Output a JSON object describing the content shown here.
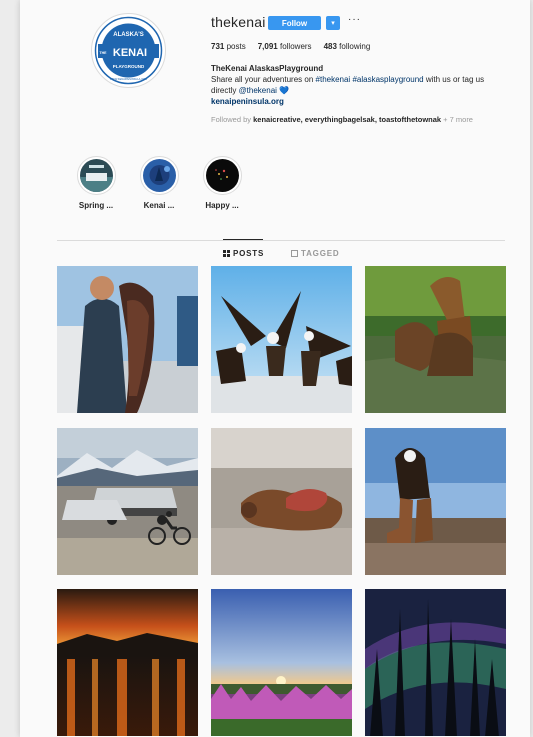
{
  "profile": {
    "username": "thekenai",
    "follow_label": "Follow",
    "more_label": "···",
    "dropdown_label": "▾",
    "stats": {
      "posts_count": "731",
      "posts_label": "posts",
      "followers_count": "7,091",
      "followers_label": "followers",
      "following_count": "483",
      "following_label": "following"
    },
    "bio": {
      "name": "TheKenai AlaskasPlayground",
      "text1": "Share all your adventures on ",
      "hashtag1": "#thekenai",
      "hashtag2": "#alaskasplayground",
      "text2": " with us or tag us directly ",
      "mention": "@thekenai",
      "heart": "💙",
      "website": "kenaipeninsula.org"
    },
    "followed_by": {
      "prefix": "Followed by ",
      "names": "kenaicreative, everythingbagelsak, toastofthetownak",
      "suffix": " + 7 more"
    },
    "logo": {
      "top_text": "ALASKA'S",
      "main_text": "KENAI",
      "bottom_text": "PLAYGROUND",
      "side_text": "THE",
      "url_text": "WWW.KENAIPENINSULA.ORG"
    }
  },
  "highlights": [
    {
      "label": "Spring ..."
    },
    {
      "label": "Kenai ..."
    },
    {
      "label": "Happy ..."
    }
  ],
  "tabs": {
    "posts": "POSTS",
    "tagged": "TAGGED"
  },
  "colors": {
    "accent": "#3897f0",
    "link": "#003569",
    "logo_blue": "#1f66b0"
  }
}
